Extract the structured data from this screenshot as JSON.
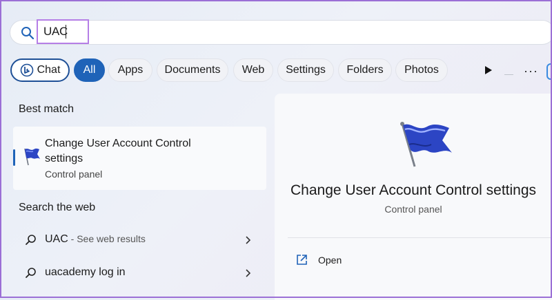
{
  "search": {
    "query": "UAC"
  },
  "filters": {
    "chat": "Chat",
    "all": "All",
    "apps": "Apps",
    "documents": "Documents",
    "web": "Web",
    "settings": "Settings",
    "folders": "Folders",
    "photos": "Photos",
    "more": "···"
  },
  "left": {
    "best_match_heading": "Best match",
    "best_match": {
      "title": "Change User Account Control settings",
      "subtitle": "Control panel"
    },
    "search_web_heading": "Search the web",
    "web_results": [
      {
        "text": "UAC",
        "suffix": " - See web results"
      },
      {
        "text": "uacademy log in",
        "suffix": ""
      }
    ]
  },
  "detail": {
    "title": "Change User Account Control settings",
    "subtitle": "Control panel",
    "actions": [
      {
        "label": "Open"
      }
    ]
  },
  "colors": {
    "accent": "#1f63b8",
    "highlight_border": "#b57ee6",
    "flag_blue": "#2c45c4"
  }
}
